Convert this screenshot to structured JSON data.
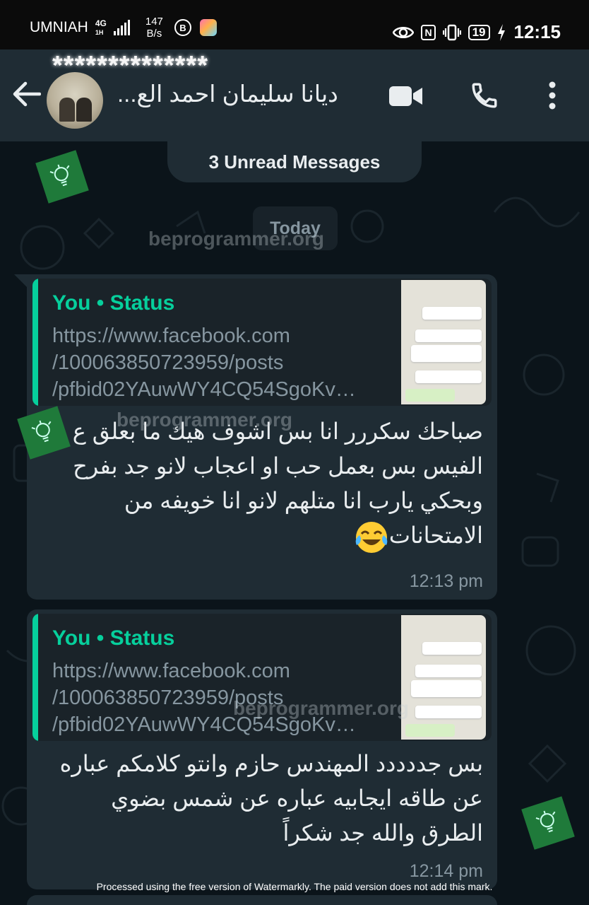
{
  "status_bar": {
    "carrier": "UMNIAH",
    "network": "4G",
    "network_sub": "1H",
    "speed_value": "147",
    "speed_unit": "B/s",
    "b_badge": "B",
    "nfc": "N",
    "battery": "19",
    "time": "12:15"
  },
  "header": {
    "masked_name": "**************",
    "contact_name": "ديانا سليمان احمد الع...",
    "icons": [
      "back-arrow-icon",
      "video-call-icon",
      "voice-call-icon",
      "more-options-icon"
    ]
  },
  "chat": {
    "unread_banner": "3 Unread Messages",
    "date_chip": "Today",
    "messages": [
      {
        "quote_sender": "You • Status",
        "quote_text": "https://www.facebook.com /100063850723959/posts /pfbid02YAuwWY4CQ54SgoKv…",
        "text": "صباحك سكررر انا بس اشوف هيك ما بعلق ع الفيس بس بعمل حب او اعجاب لانو جد بفرح وبحكي يارب انا متلهم لانو انا خويفه من الامتحانات",
        "emoji": "face-with-tears-of-joy",
        "time": "12:13 pm"
      },
      {
        "quote_sender": "You • Status",
        "quote_text": "https://www.facebook.com /100063850723959/posts /pfbid02YAuwWY4CQ54SgoKv…",
        "text": "بس جددددد المهندس حازم وانتو كلامكم عباره عن طاقه ايجابيه عباره عن شمس بضوي الطرق والله جد شكراً",
        "time": "12:14 pm"
      }
    ]
  },
  "watermarks": {
    "site": "beprogrammer.org",
    "footer": "Processed using the free version of Watermarkly. The paid version does not add this mark."
  }
}
